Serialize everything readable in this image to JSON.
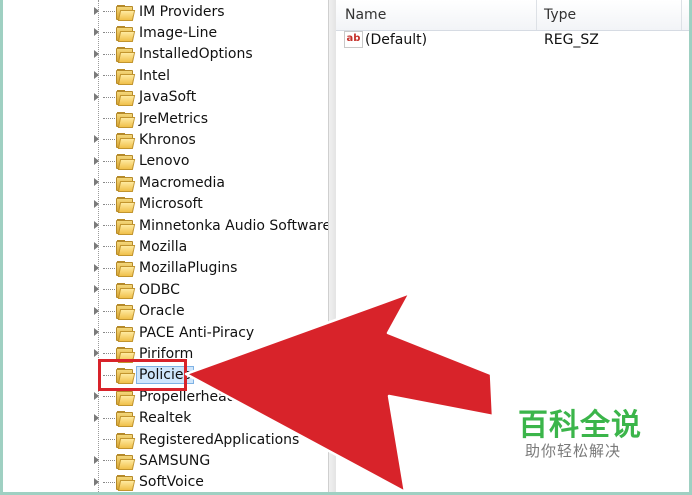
{
  "tree": {
    "items": [
      {
        "label": "IM Providers",
        "expandable": true
      },
      {
        "label": "Image-Line",
        "expandable": true
      },
      {
        "label": "InstalledOptions",
        "expandable": true
      },
      {
        "label": "Intel",
        "expandable": true
      },
      {
        "label": "JavaSoft",
        "expandable": true
      },
      {
        "label": "JreMetrics",
        "expandable": false
      },
      {
        "label": "Khronos",
        "expandable": true
      },
      {
        "label": "Lenovo",
        "expandable": true
      },
      {
        "label": "Macromedia",
        "expandable": true
      },
      {
        "label": "Microsoft",
        "expandable": true
      },
      {
        "label": "Minnetonka Audio Software",
        "expandable": true
      },
      {
        "label": "Mozilla",
        "expandable": true
      },
      {
        "label": "MozillaPlugins",
        "expandable": true
      },
      {
        "label": "ODBC",
        "expandable": true
      },
      {
        "label": "Oracle",
        "expandable": true
      },
      {
        "label": "PACE Anti-Piracy",
        "expandable": true
      },
      {
        "label": "Piriform",
        "expandable": true
      },
      {
        "label": "Policies",
        "expandable": false,
        "selected": true
      },
      {
        "label": "Propellerhead",
        "expandable": true
      },
      {
        "label": "Realtek",
        "expandable": true
      },
      {
        "label": "RegisteredApplications",
        "expandable": false
      },
      {
        "label": "SAMSUNG",
        "expandable": true
      },
      {
        "label": "SoftVoice",
        "expandable": true
      }
    ]
  },
  "list": {
    "columns": {
      "name": "Name",
      "type": "Type"
    },
    "rows": [
      {
        "icon": "ab",
        "name": "(Default)",
        "type": "REG_SZ"
      }
    ]
  },
  "annotation": {
    "arrow_color": "#d8232a",
    "highlight_color": "#d8232a"
  },
  "watermark": {
    "title": "百科全说",
    "subtitle": "助你轻松解决"
  }
}
